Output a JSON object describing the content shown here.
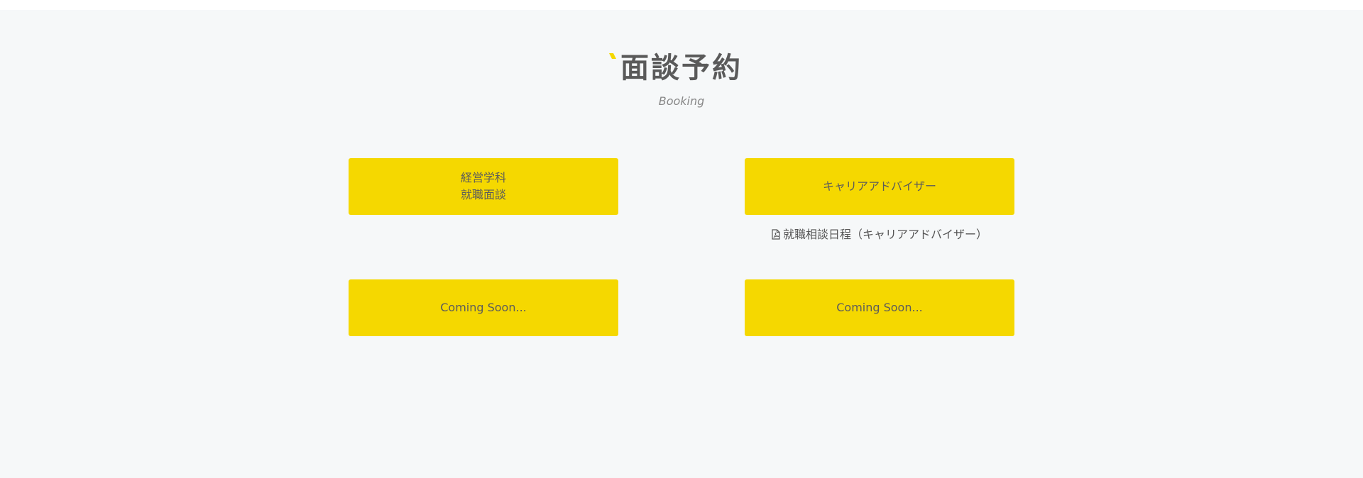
{
  "page": {
    "title": "面談予約",
    "subtitle": "Booking"
  },
  "buttons": [
    {
      "label_lines": [
        "経営学科",
        "就職面談"
      ]
    },
    {
      "label": "キャリアアドバイザー"
    },
    {
      "label": "Coming Soon..."
    },
    {
      "label": "Coming Soon..."
    }
  ],
  "schedule_link": {
    "icon": "pdf-file-icon",
    "label": "就職相談日程（キャリアアドバイザー）"
  },
  "colors": {
    "accent": "#f5d800",
    "background": "#f6f8f9",
    "text": "#555555"
  }
}
